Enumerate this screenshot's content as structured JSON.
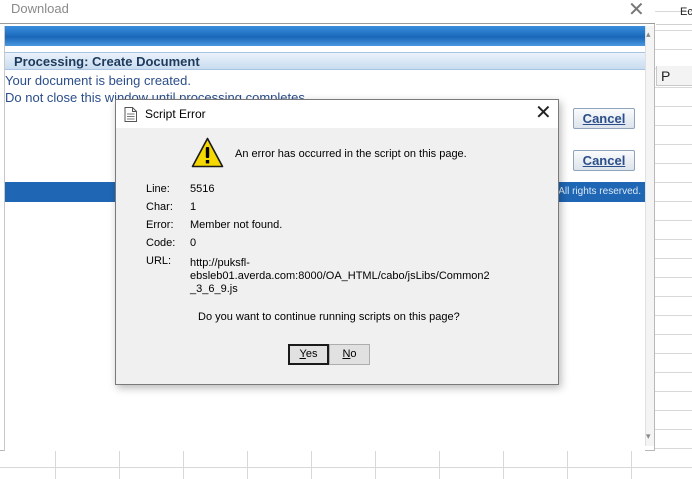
{
  "spreadsheet": {
    "ribbon_text": "Ec",
    "column_header": "P"
  },
  "download_window": {
    "title": "Download",
    "header_title": "Processing: Create Document",
    "message_line1": "Your document is being created.",
    "message_line2": "Do not close this window until processing completes.",
    "cancel_button_1": {
      "accel": "a",
      "pre": "C",
      "post": "ncel"
    },
    "cancel_button_2": {
      "accel": "a",
      "pre": "C",
      "post": "ncel"
    },
    "footer_text": "All rights reserved.",
    "colors": {
      "accent": "#1f67b5",
      "text": "#2b4e8a"
    }
  },
  "script_error_dialog": {
    "title": "Script Error",
    "message": "An error has occurred in the script on this page.",
    "fields": {
      "line_label": "Line:",
      "line_value": "5516",
      "char_label": "Char:",
      "char_value": "1",
      "error_label": "Error:",
      "error_value": "Member not found.",
      "code_label": "Code:",
      "code_value": "0",
      "url_label": "URL:",
      "url_lines": [
        "http://puksfl-",
        "ebsleb01.averda.com:8000/OA_HTML/cabo/jsLibs/Common2",
        "_3_6_9.js"
      ]
    },
    "question": "Do you want to continue running scripts on this page?",
    "yes_button": {
      "accel": "Y",
      "rest": "es"
    },
    "no_button": {
      "accel": "N",
      "rest": "o"
    },
    "icons": {
      "document": "document-icon",
      "warning": "warning-icon",
      "close": "close-icon"
    }
  }
}
